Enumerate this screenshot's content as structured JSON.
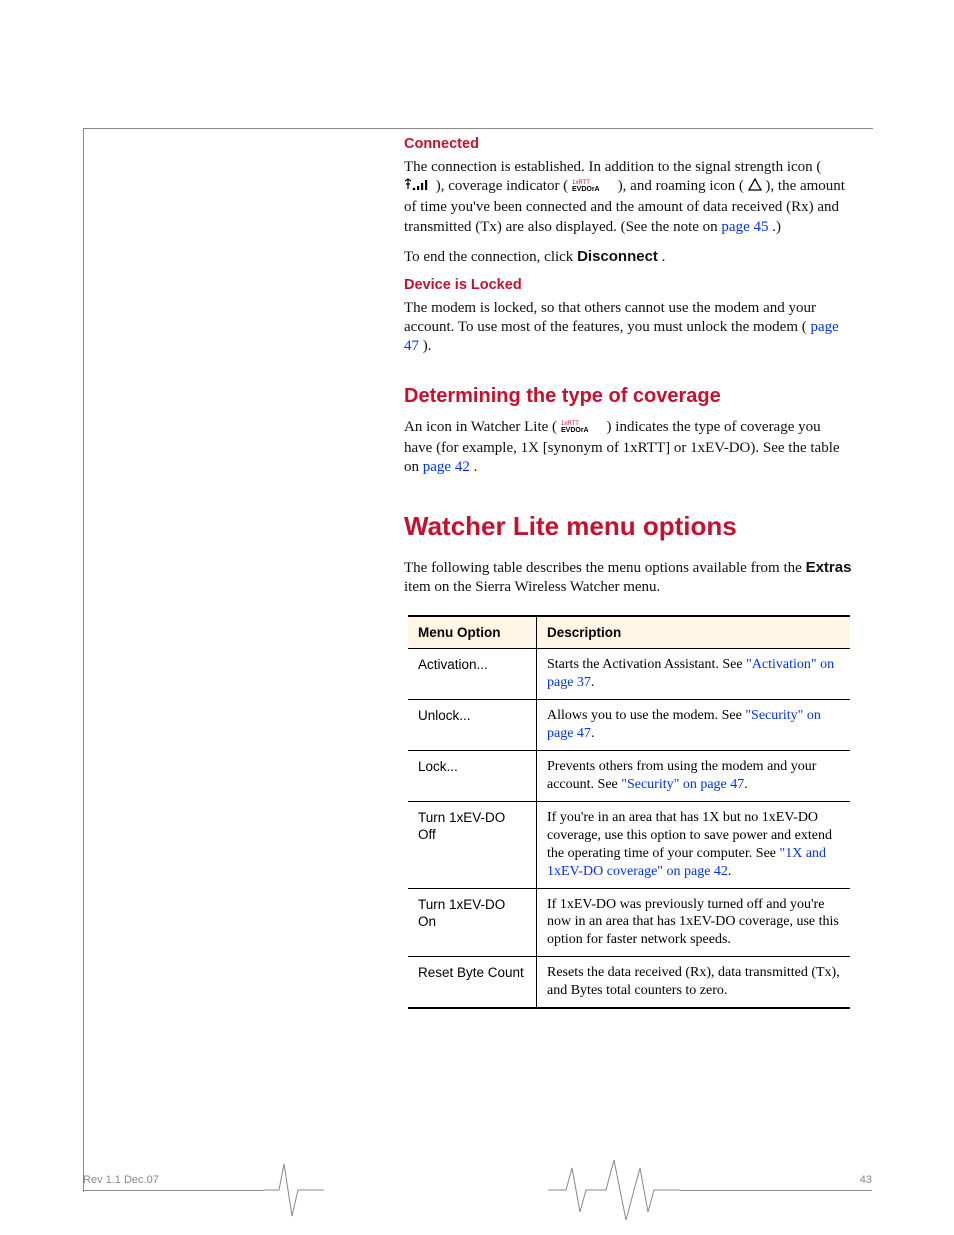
{
  "sections": {
    "connected": {
      "title": "Connected",
      "p1a": "The connection is established. In addition to the signal strength icon (",
      "p1b": "), coverage indicator (",
      "p1c": "), and roaming icon (",
      "p1d": "), the amount of time you've been connected and the amount of data received (Rx) and transmitted (Tx) are also displayed. (See the note on ",
      "page45": "page 45",
      "p1e": ".)",
      "p2a": "To end the connection, click ",
      "disconnect": "Disconnect",
      "p2b": "."
    },
    "locked": {
      "title": "Device is Locked",
      "p1a": "The modem is locked, so that others cannot use the modem and your account. To use most of the features, you must unlock the modem (",
      "page47": "page 47",
      "p1b": ")."
    },
    "coverage": {
      "title": "Determining the type of coverage",
      "p1a": "An icon in Watcher Lite (",
      "p1b": ") indicates the type of coverage you have (for example, 1X [synonym of 1xRTT] or 1xEV-DO). See the table on ",
      "page42": "page 42",
      "p1c": "."
    },
    "menu": {
      "title": "Watcher Lite menu options",
      "intro_a": "The following table describes the menu options available from the ",
      "extras": "Extras",
      "intro_b": " item on the Sierra Wireless Watcher menu."
    }
  },
  "table": {
    "headers": [
      "Menu Option",
      "Description"
    ],
    "rows": [
      {
        "option": "Activation...",
        "desc_a": "Starts the Activation Assistant. See ",
        "link": "\"Activation\" on page 37",
        "desc_b": "."
      },
      {
        "option": "Unlock...",
        "desc_a": "Allows you to use the modem. See ",
        "link": "\"Security\" on page 47",
        "desc_b": "."
      },
      {
        "option": "Lock...",
        "desc_a": "Prevents others from using the modem and your account. See ",
        "link": "\"Security\" on page 47",
        "desc_b": "."
      },
      {
        "option": "Turn 1xEV-DO Off",
        "desc_a": "If you're in an area that has 1X but no 1xEV-DO coverage, use this option to save power and extend the operating time of your computer. See ",
        "link": "\"1X and 1xEV-DO coverage\" on page 42",
        "desc_b": "."
      },
      {
        "option": "Turn 1xEV-DO On",
        "desc_a": "If 1xEV-DO was previously turned off and you're now in an area that has 1xEV-DO coverage, use this option for faster network speeds.",
        "link": "",
        "desc_b": ""
      },
      {
        "option": "Reset Byte Count",
        "desc_a": "Resets the data received (Rx), data transmitted (Tx), and Bytes total counters to zero.",
        "link": "",
        "desc_b": ""
      }
    ]
  },
  "footer": {
    "rev": "Rev 1.1  Dec.07",
    "page": "43"
  }
}
